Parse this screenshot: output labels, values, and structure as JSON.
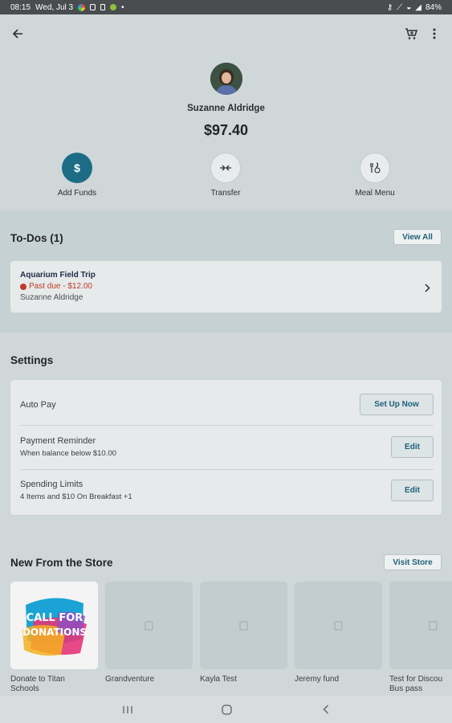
{
  "status_bar": {
    "time": "08:15",
    "date": "Wed, Jul 3",
    "battery": "84%"
  },
  "profile": {
    "name": "Suzanne Aldridge",
    "balance": "$97.40"
  },
  "actions": [
    {
      "label": "Add Funds",
      "icon": "dollar-icon"
    },
    {
      "label": "Transfer",
      "icon": "transfer-icon"
    },
    {
      "label": "Meal Menu",
      "icon": "meal-menu-icon"
    }
  ],
  "todos": {
    "title": "To-Dos (1)",
    "view_all": "View All",
    "item": {
      "title": "Aquarium Field Trip",
      "status": "Past due - $12.00",
      "person": "Suzanne Aldridge",
      "status_color": "#c0392b"
    }
  },
  "settings": {
    "title": "Settings",
    "rows": [
      {
        "label": "Auto Pay",
        "sub": "",
        "button": "Set Up Now"
      },
      {
        "label": "Payment Reminder",
        "sub": "When balance below $10.00",
        "button": "Edit"
      },
      {
        "label": "Spending Limits",
        "sub": "4 Items and $10 On Breakfast +1",
        "button": "Edit"
      }
    ]
  },
  "store": {
    "title": "New From the Store",
    "visit": "Visit Store",
    "items": [
      {
        "label": "Donate to Titan Schools",
        "image_text": "CALL FOR DONATIONS"
      },
      {
        "label": "Grandventure"
      },
      {
        "label": "Kayla Test"
      },
      {
        "label": "Jeremy fund"
      },
      {
        "label": "Test for Discou Bus pass"
      }
    ]
  },
  "colors": {
    "accent": "#1d6c86",
    "background": "#d0d7d9",
    "section": "#c6d1d3"
  }
}
